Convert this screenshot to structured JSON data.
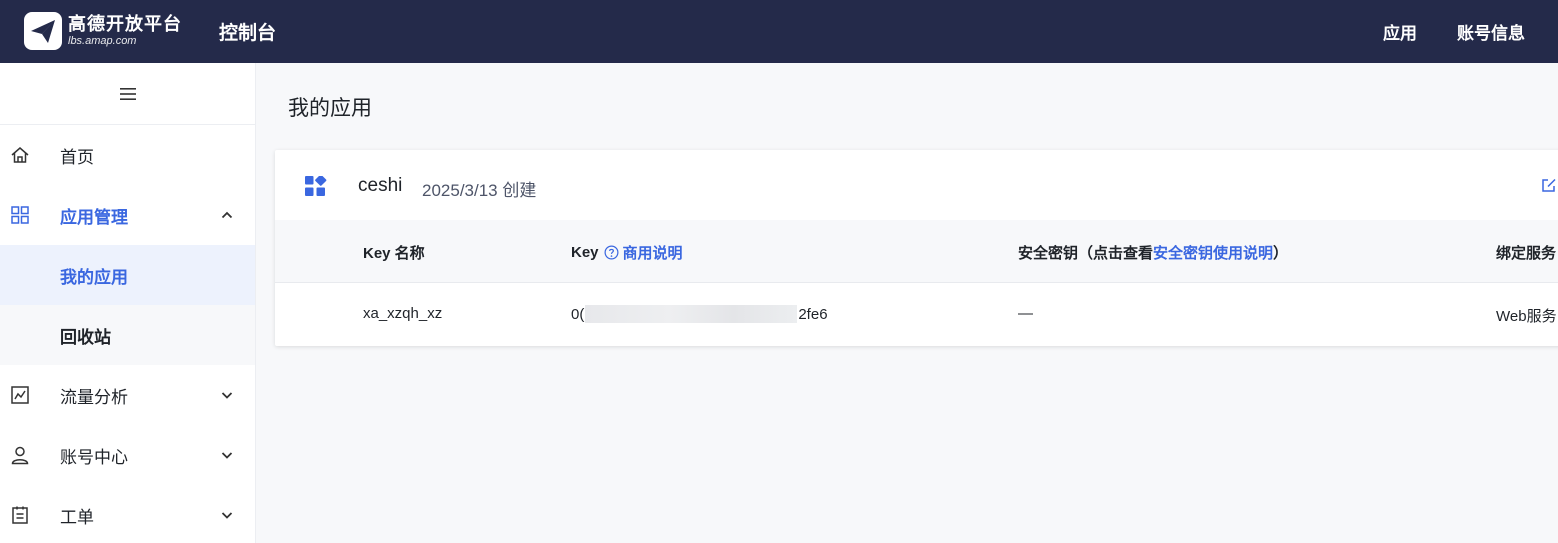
{
  "header": {
    "logo_cn": "高德开放平台",
    "logo_url": "lbs.amap.com",
    "console_title": "控制台",
    "nav": [
      "应用",
      "账号信息"
    ]
  },
  "sidebar": {
    "items": [
      {
        "label": "首页",
        "icon": "home-icon"
      },
      {
        "label": "应用管理",
        "icon": "grid-icon",
        "expanded": true,
        "children": [
          {
            "label": "我的应用",
            "selected": true
          },
          {
            "label": "回收站"
          }
        ]
      },
      {
        "label": "流量分析",
        "icon": "chart-icon"
      },
      {
        "label": "账号中心",
        "icon": "user-icon"
      },
      {
        "label": "工单",
        "icon": "ticket-icon"
      }
    ]
  },
  "main": {
    "page_title": "我的应用",
    "app": {
      "name": "ceshi",
      "created": "2025/3/13 创建",
      "columns": {
        "key_name": "Key 名称",
        "key": "Key",
        "key_link": "商用说明",
        "secret_prefix": "安全密钥（点击查看",
        "secret_link": "安全密钥使用说明",
        "secret_suffix": "）",
        "service": "绑定服务"
      },
      "row": {
        "key_name": "xa_xzqh_xz",
        "key_prefix": "0(",
        "key_suffix": "2fe6",
        "secret": "—",
        "service": "Web服务"
      }
    }
  },
  "colors": {
    "topbar": "#242a4a",
    "accent": "#3a67e0",
    "page_bg": "#f7f8fa"
  }
}
